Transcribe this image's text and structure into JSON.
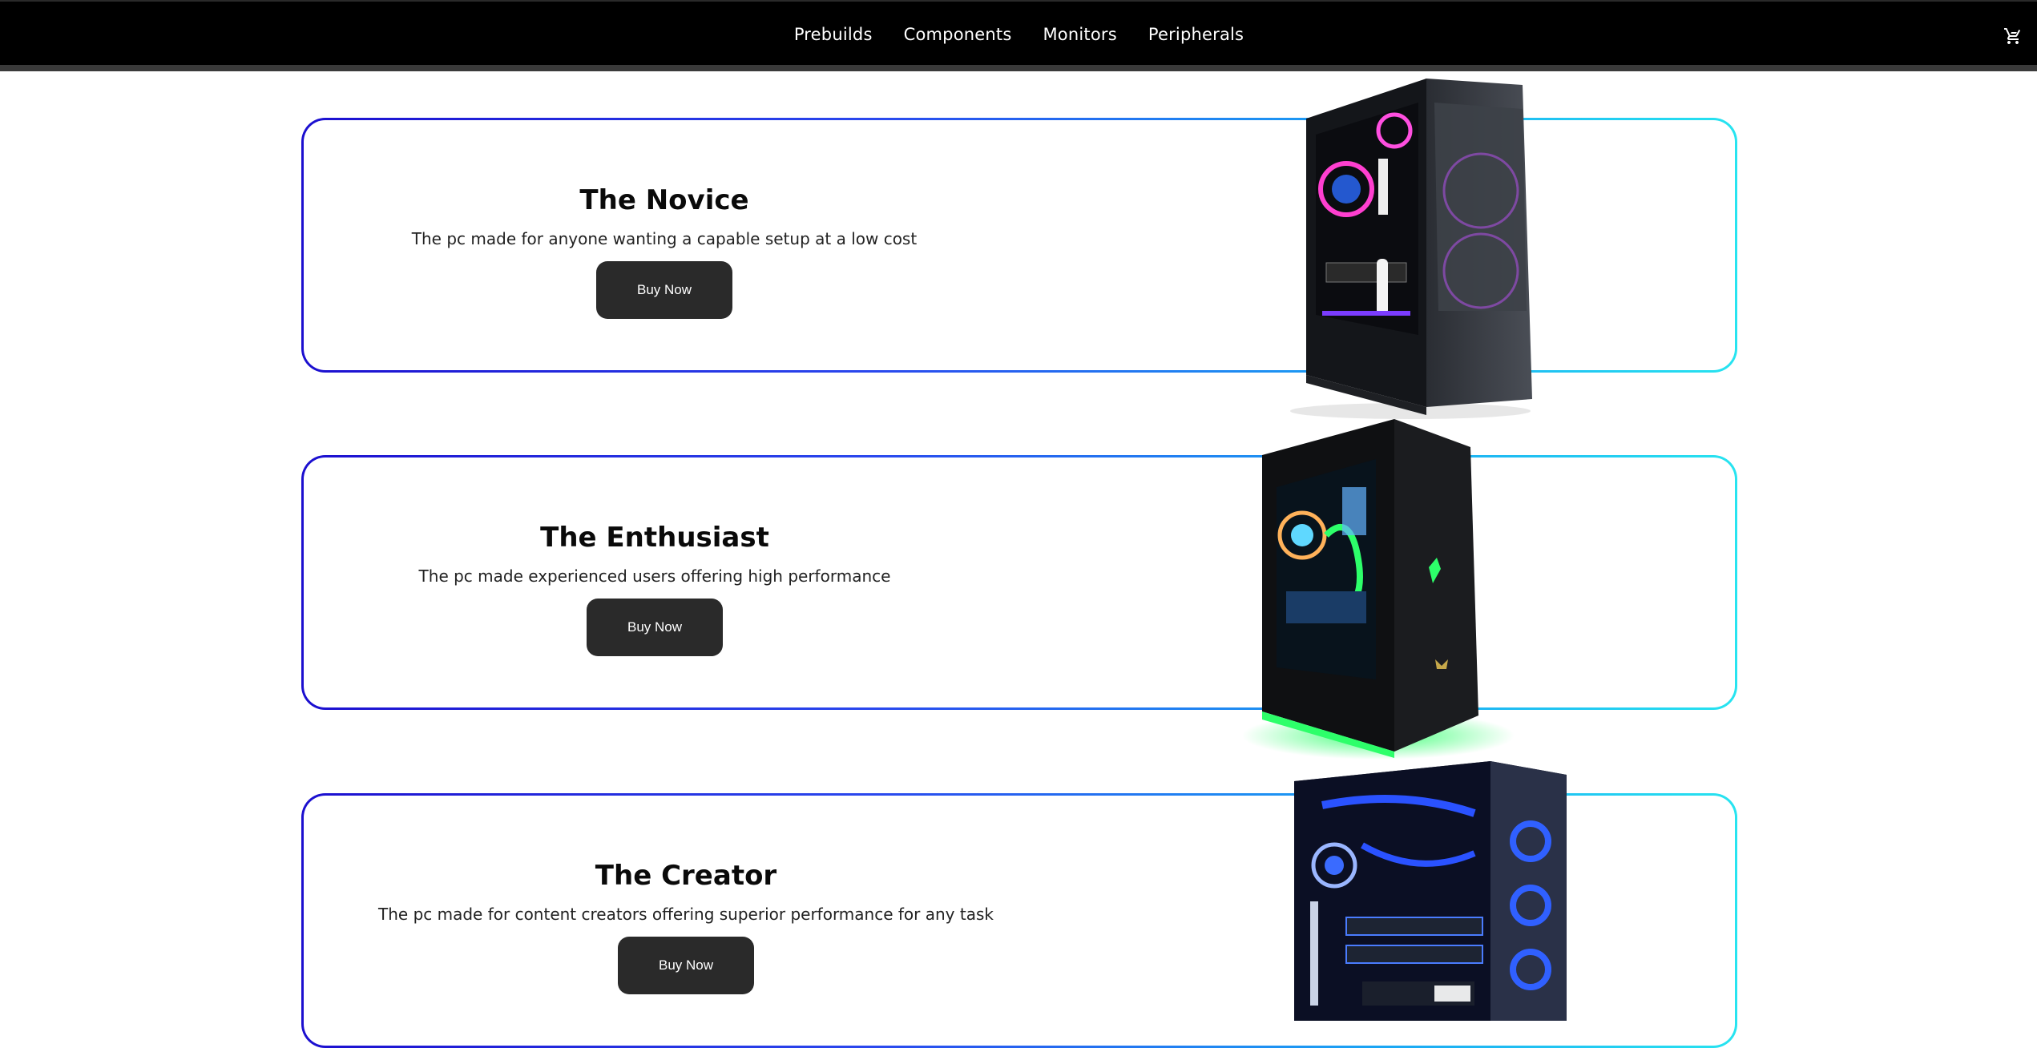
{
  "nav": {
    "links": [
      "Prebuilds",
      "Components",
      "Monitors",
      "Peripherals"
    ],
    "cart_icon": "shopping-cart-icon"
  },
  "products": [
    {
      "title": "The Novice",
      "description": "The pc made for anyone wanting a capable setup at a low cost",
      "button": "Buy Now",
      "accent": "#d36bff"
    },
    {
      "title": "The Enthusiast",
      "description": "The pc made experienced users offering high performance",
      "button": "Buy Now",
      "accent": "#2dff6a"
    },
    {
      "title": "The Creator",
      "description": "The pc made for content creators offering superior performance for any task",
      "button": "Buy Now",
      "accent": "#2a4bff"
    }
  ],
  "colors": {
    "nav_bg": "#000000",
    "button_bg": "#2a2a2a",
    "border_start": "#1c0fcf",
    "border_end": "#27e4f0"
  }
}
